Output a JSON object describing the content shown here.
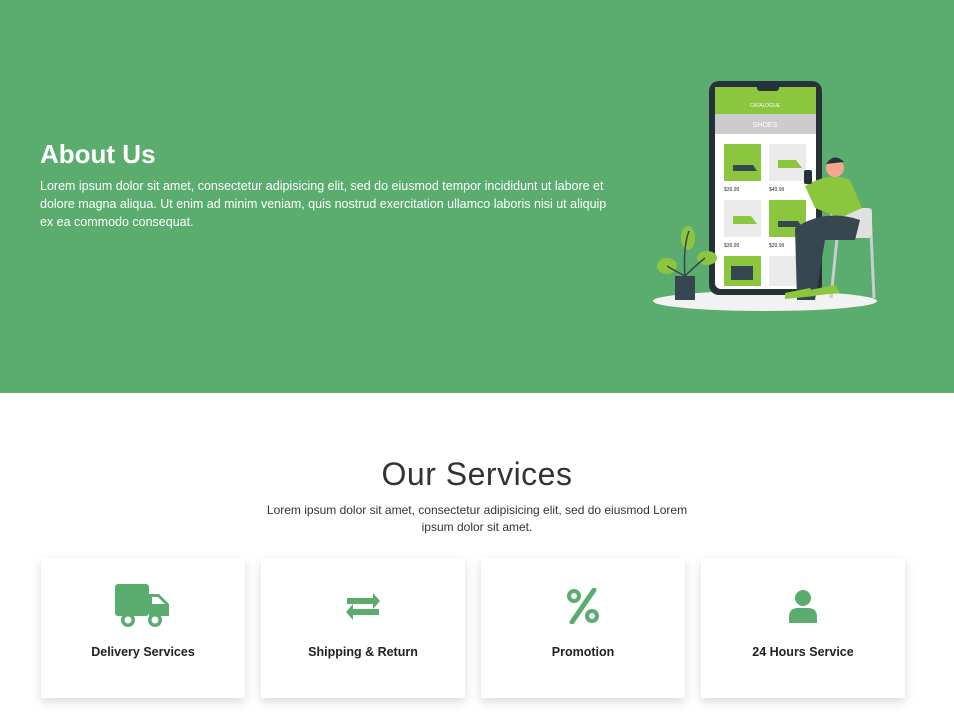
{
  "about": {
    "title": "About Us",
    "text": "Lorem ipsum dolor sit amet, consectetur adipisicing elit, sed do eiusmod tempor incididunt ut labore et dolore magna aliqua. Ut enim ad minim veniam, quis nostrud exercitation ullamco laboris nisi ut aliquip ex ea commodo consequat."
  },
  "illustration": {
    "header": "CATALOGUE",
    "category": "SHOES",
    "prices": [
      "$39.99",
      "$49.99",
      "$39.99",
      "$39.99"
    ]
  },
  "services": {
    "title": "Our Services",
    "text": "Lorem ipsum dolor sit amet, consectetur adipisicing elit, sed do eiusmod Lorem ipsum dolor sit amet.",
    "items": [
      {
        "label": "Delivery Services",
        "icon": "truck-icon"
      },
      {
        "label": "Shipping & Return",
        "icon": "exchange-arrows-icon"
      },
      {
        "label": "Promotion",
        "icon": "percent-icon"
      },
      {
        "label": "24 Hours Service",
        "icon": "user-icon"
      }
    ]
  },
  "colors": {
    "brand": "#5aad6e",
    "accent": "#8cc63f",
    "text": "#222222"
  }
}
